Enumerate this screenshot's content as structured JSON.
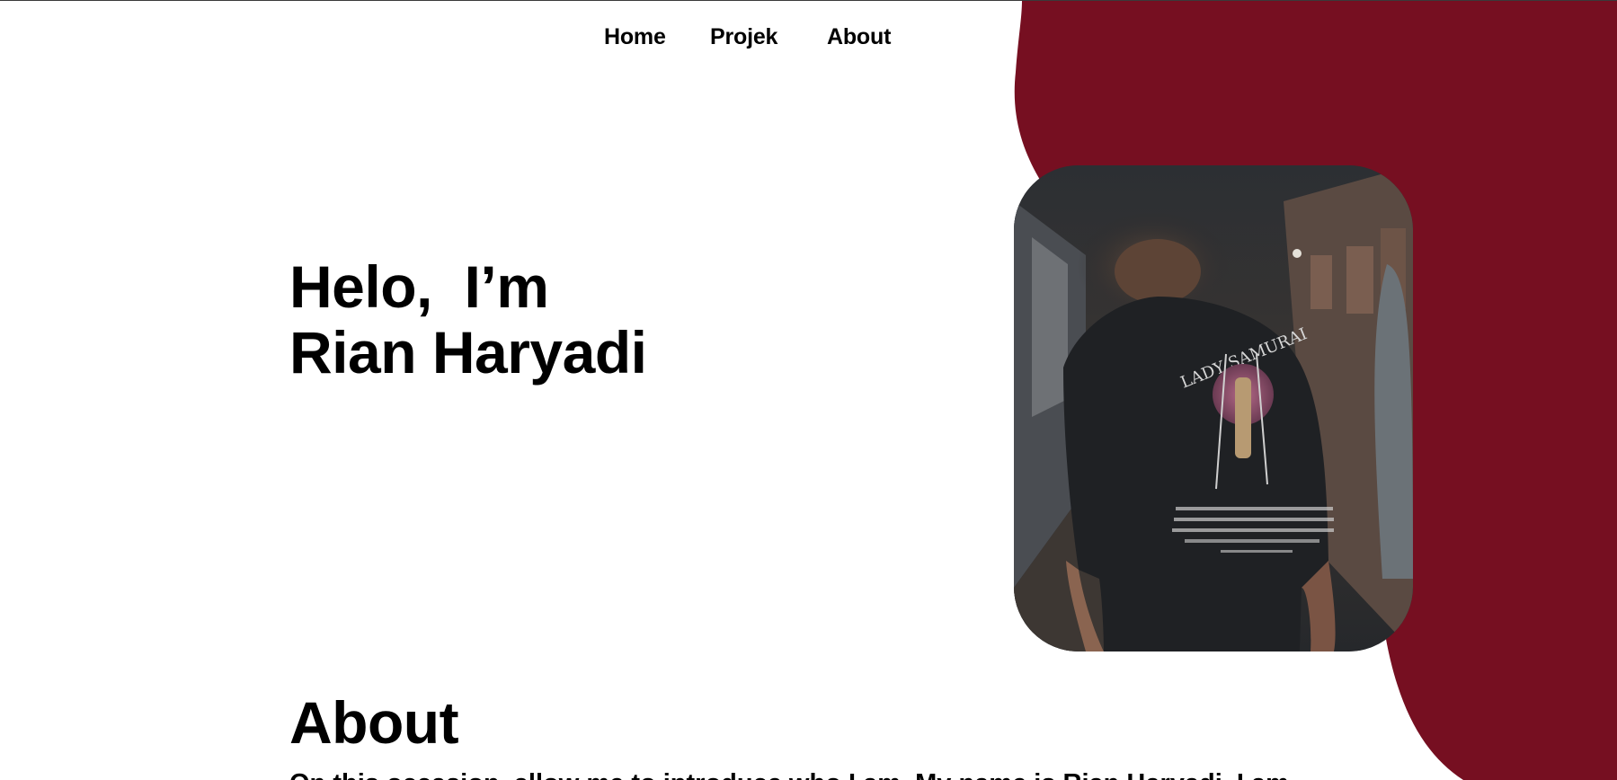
{
  "nav": {
    "items": [
      {
        "label": "Home"
      },
      {
        "label": "Projek"
      },
      {
        "label": "About"
      }
    ]
  },
  "hero": {
    "greeting": "Helo,  I’m",
    "name": "Rian Haryadi"
  },
  "photo": {
    "shirt_print_title": "LADY SAMURAI"
  },
  "about": {
    "heading": "About",
    "text": "On this occasion, allow me to introduce who I am. My name is Rian Haryadi, I am"
  },
  "colors": {
    "accent": "#760f21",
    "text": "#000000",
    "background": "#ffffff"
  }
}
